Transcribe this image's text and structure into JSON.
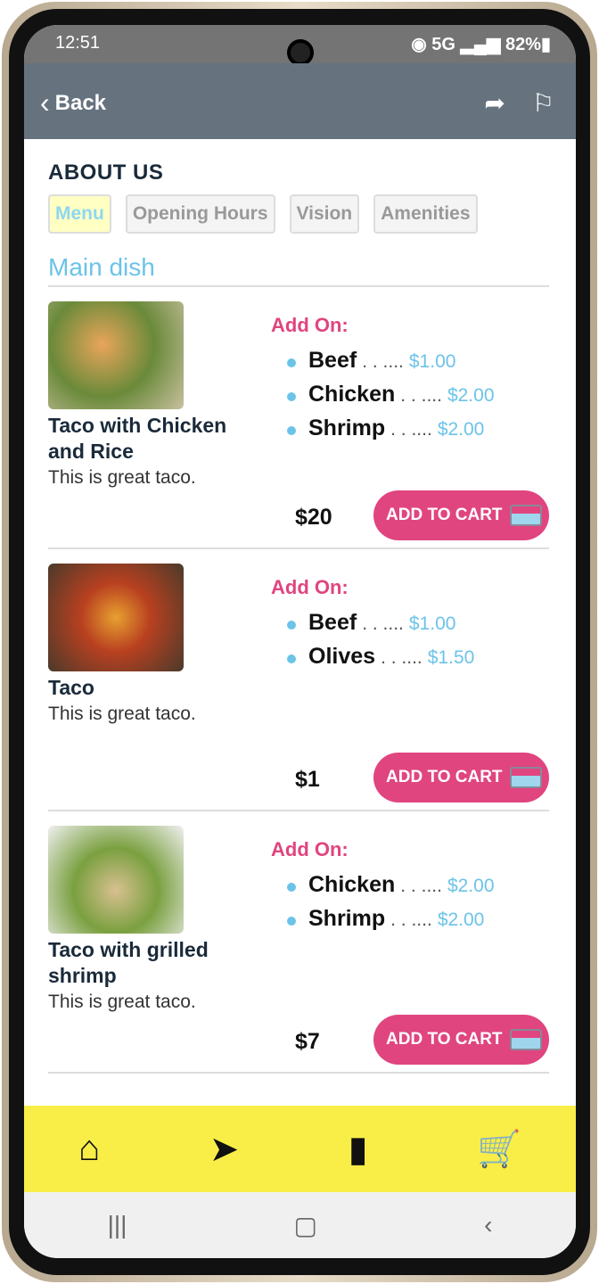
{
  "status": {
    "time": "12:51",
    "network": "5G",
    "battery": "82%"
  },
  "header": {
    "back_label": "Back"
  },
  "about_title": "ABOUT US",
  "tabs": [
    {
      "label": "Menu",
      "active": true
    },
    {
      "label": "Opening Hours"
    },
    {
      "label": "Vision"
    },
    {
      "label": "Amenities"
    }
  ],
  "section": "Main dish",
  "addon_label": "Add On:",
  "cart_label": "ADD TO CART",
  "items": [
    {
      "name": "Taco with Chicken and Rice",
      "desc": "This is great taco.",
      "price": "$20",
      "addons": [
        {
          "name": "Beef",
          "dots": ". . ....",
          "price": "$1.00"
        },
        {
          "name": "Chicken",
          "dots": ". . ....",
          "price": "$2.00"
        },
        {
          "name": "Shrimp",
          "dots": ". . ....",
          "price": "$2.00"
        }
      ]
    },
    {
      "name": "Taco",
      "desc": "This is great taco.",
      "price": "$1",
      "addons": [
        {
          "name": "Beef",
          "dots": ". . ....",
          "price": "$1.00"
        },
        {
          "name": "Olives",
          "dots": ". . ....",
          "price": "$1.50"
        }
      ]
    },
    {
      "name": "Taco with grilled shrimp",
      "desc": "This is great taco.",
      "price": "$7",
      "addons": [
        {
          "name": "Chicken",
          "dots": ". . ....",
          "price": "$2.00"
        },
        {
          "name": "Shrimp",
          "dots": ". . ....",
          "price": "$2.00"
        }
      ]
    }
  ],
  "colors": {
    "accent": "#e0457f",
    "nav_bar": "#f9ee48",
    "link": "#6cc3e8"
  }
}
